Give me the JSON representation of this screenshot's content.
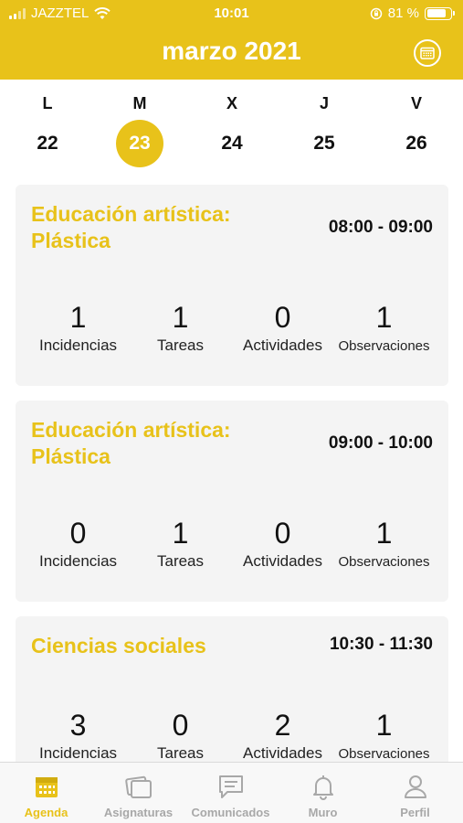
{
  "status_bar": {
    "carrier": "JAZZTEL",
    "time": "10:01",
    "battery": "81 %",
    "battery_level": 0.81
  },
  "header": {
    "title": "marzo 2021",
    "calendar_icon": "calendar-icon"
  },
  "week": {
    "days": [
      {
        "letter": "L",
        "number": "22",
        "selected": false
      },
      {
        "letter": "M",
        "number": "23",
        "selected": true
      },
      {
        "letter": "X",
        "number": "24",
        "selected": false
      },
      {
        "letter": "J",
        "number": "25",
        "selected": false
      },
      {
        "letter": "V",
        "number": "26",
        "selected": false
      }
    ]
  },
  "stat_labels": [
    "Incidencias",
    "Tareas",
    "Actividades",
    "Observaciones"
  ],
  "sessions": [
    {
      "subject": "Educación artística: Plástica",
      "time": "08:00 - 09:00",
      "counts": [
        "1",
        "1",
        "0",
        "1"
      ]
    },
    {
      "subject": "Educación artística: Plástica",
      "time": "09:00 - 10:00",
      "counts": [
        "0",
        "1",
        "0",
        "1"
      ]
    },
    {
      "subject": "Ciencias sociales",
      "time": "10:30 - 11:30",
      "counts": [
        "3",
        "0",
        "2",
        "1"
      ]
    }
  ],
  "tabs": [
    {
      "label": "Agenda",
      "icon": "agenda-icon",
      "active": true
    },
    {
      "label": "Asignaturas",
      "icon": "subjects-icon",
      "active": false
    },
    {
      "label": "Comunicados",
      "icon": "chat-icon",
      "active": false
    },
    {
      "label": "Muro",
      "icon": "bell-icon",
      "active": false
    },
    {
      "label": "Perfil",
      "icon": "profile-icon",
      "active": false
    }
  ],
  "colors": {
    "accent": "#e8c21a",
    "card_bg": "#f4f4f4",
    "tab_inactive": "#a8a8a8"
  }
}
